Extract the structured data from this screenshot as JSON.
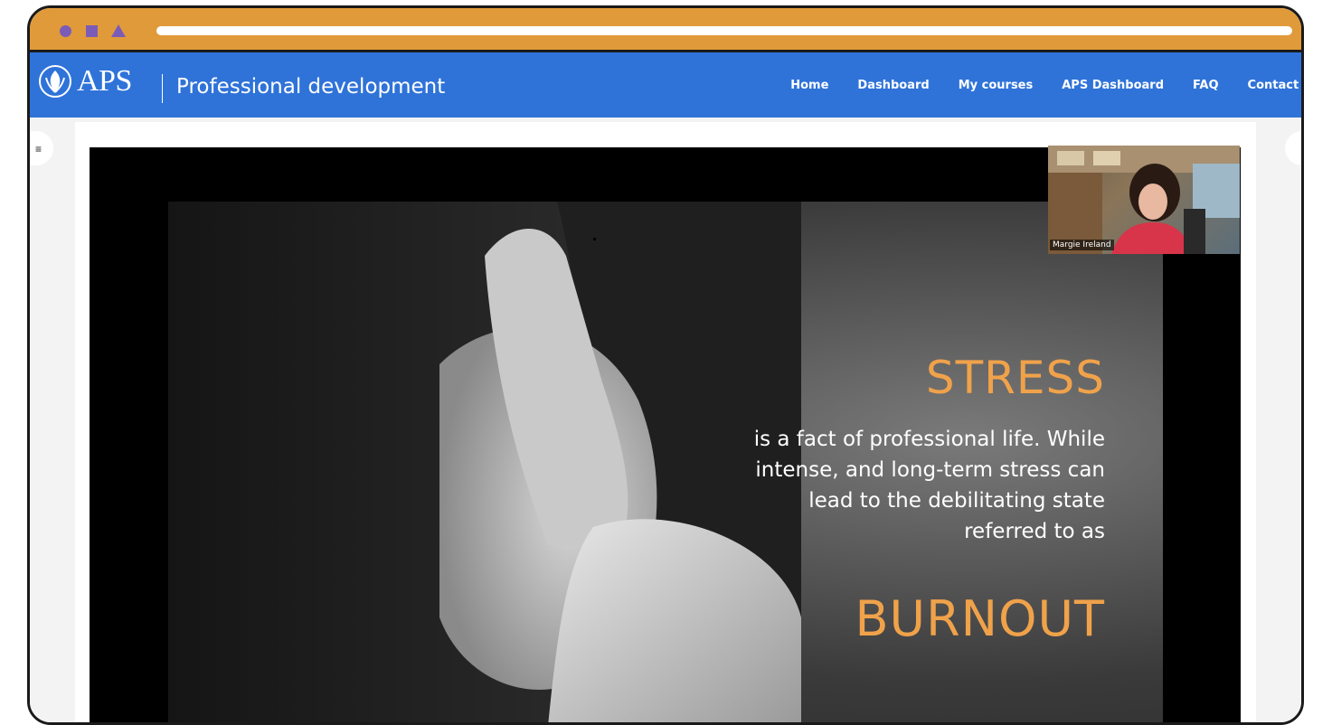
{
  "header": {
    "logo_text": "APS",
    "subtitle": "Professional development",
    "nav": [
      {
        "label": "Home"
      },
      {
        "label": "Dashboard"
      },
      {
        "label": "My courses"
      },
      {
        "label": "APS Dashboard"
      },
      {
        "label": "FAQ"
      },
      {
        "label": "Contact Us"
      }
    ]
  },
  "slide": {
    "headline": "STRESS",
    "body_lines": [
      "is a fact of professional life. While",
      "intense, and long-term stress can",
      "lead to the debilitating state",
      "referred to as"
    ],
    "conclusion": "BURNOUT"
  },
  "webcam": {
    "participant_name": "Margie Ireland"
  },
  "icons": {
    "drawer": "hamburger-menu-icon",
    "logo": "aps-logo-icon"
  },
  "colors": {
    "browser_bar": "#e09a3a",
    "header": "#2f73d9",
    "accent_text": "#f0a24a"
  }
}
